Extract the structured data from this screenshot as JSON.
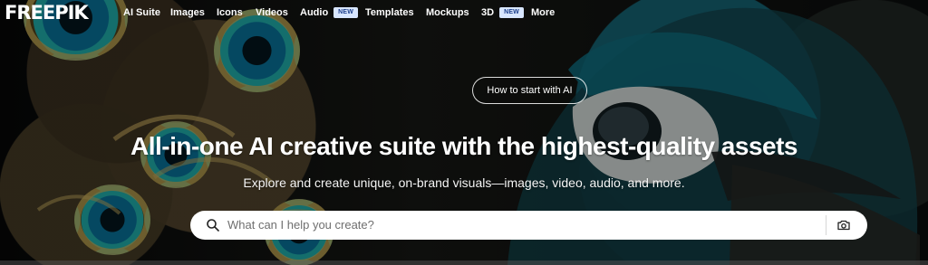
{
  "brand": {
    "name": "FREEPIK"
  },
  "navigation": [
    {
      "label": "AI Suite",
      "badge": ""
    },
    {
      "label": "Images",
      "badge": ""
    },
    {
      "label": "Icons",
      "badge": ""
    },
    {
      "label": "Videos",
      "badge": ""
    },
    {
      "label": "Audio",
      "badge": "NEW"
    },
    {
      "label": "Templates",
      "badge": ""
    },
    {
      "label": "Mockups",
      "badge": ""
    },
    {
      "label": "3D",
      "badge": "NEW"
    },
    {
      "label": "More",
      "badge": ""
    }
  ],
  "hero": {
    "pill_label": "How to start with AI",
    "title": "All-in-one AI creative suite with the highest-quality assets",
    "subtitle": "Explore and create unique, on-brand visuals—images, video, audio, and more."
  },
  "search": {
    "placeholder": "What can I help you create?",
    "value": ""
  },
  "icons": {
    "search": "search-icon",
    "image_search": "camera-icon"
  },
  "colors": {
    "background": "#0b0d0d",
    "text": "#ffffff",
    "badge_background": "#d8e6ff",
    "badge_text": "#1a3d8a"
  }
}
